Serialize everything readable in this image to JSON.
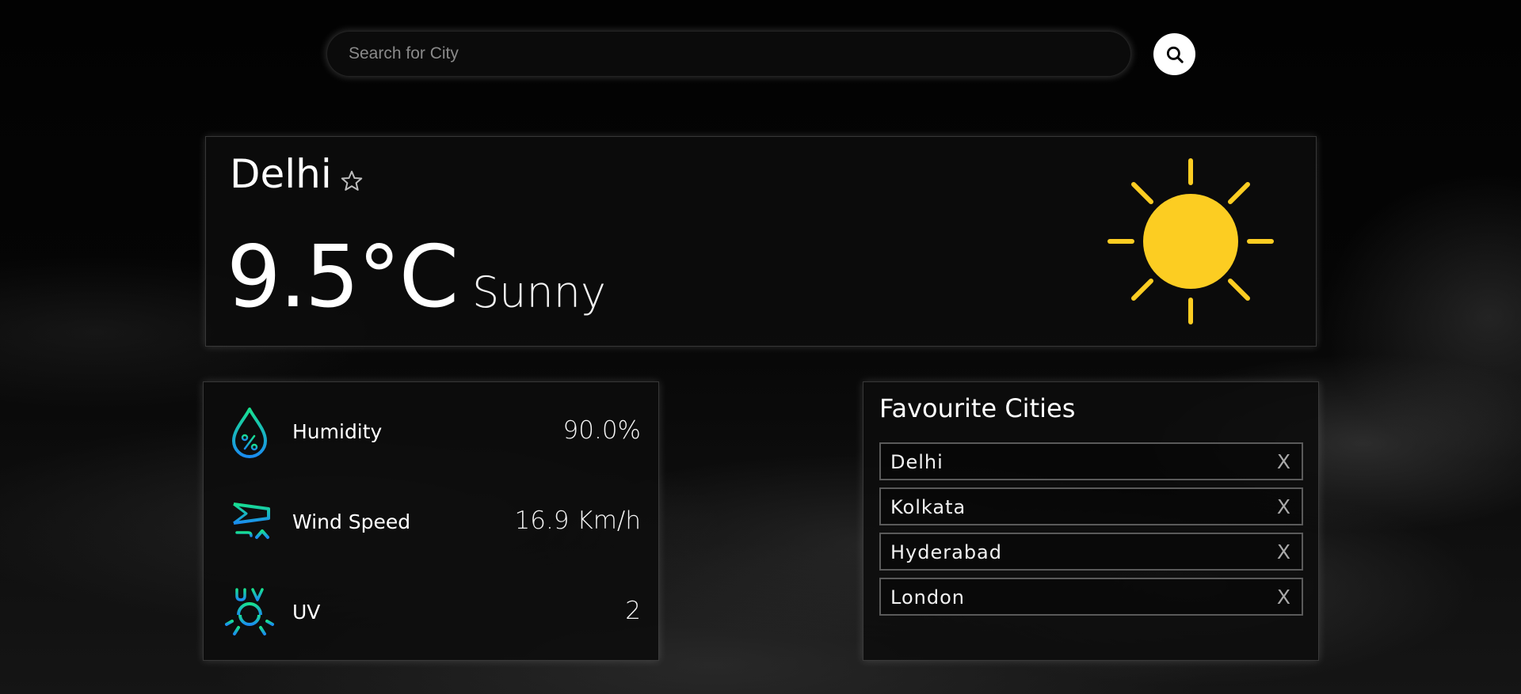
{
  "search": {
    "placeholder": "Search for City",
    "value": ""
  },
  "current": {
    "city": "Delhi",
    "favourite": false,
    "temperature": "9.5°C",
    "condition": "Sunny"
  },
  "metrics": [
    {
      "label": "Humidity",
      "value": "90.0%"
    },
    {
      "label": "Wind Speed",
      "value": "16.9 Km/h"
    },
    {
      "label": "UV",
      "value": "2"
    }
  ],
  "favourites": {
    "title": "Favourite Cities",
    "remove_label": "X",
    "cities": [
      "Delhi",
      "Kolkata",
      "Hyderabad",
      "London"
    ]
  },
  "colors": {
    "sun": "#fccd22",
    "icon_gradient_start": "#18e090",
    "icon_gradient_end": "#1a8cf0"
  },
  "icons": {
    "search": "search-icon",
    "favourite": "star-outline-icon",
    "weather": "sun-icon",
    "humidity": "humidity-drop-icon",
    "wind": "windsock-icon",
    "uv": "uv-index-icon"
  }
}
